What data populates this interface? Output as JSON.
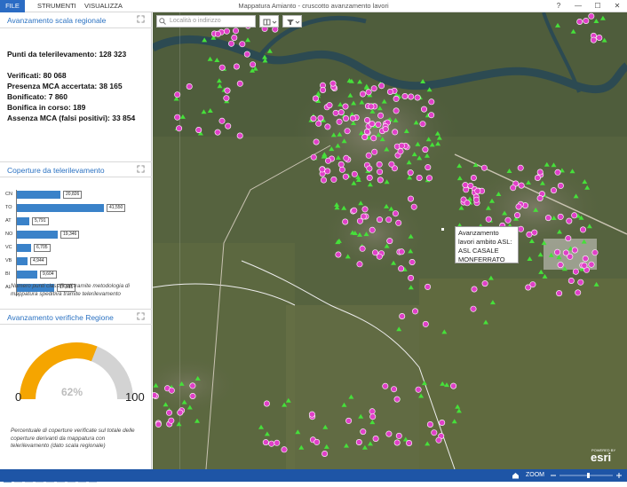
{
  "window": {
    "menu": {
      "file": "FILE",
      "tools": "STRUMENTI",
      "view": "VISUALIZZA"
    },
    "title": "Mappatura Amianto - cruscotto avanzamento lavori",
    "controls": {
      "help": "?",
      "minimize": "—",
      "maximize": "☐",
      "close": "✕"
    }
  },
  "panel1": {
    "title": "Avanzamento scala regionale",
    "lines": [
      "Punti da telerilevamento: 128 323",
      "Verificati: 80 068",
      "Presenza MCA accertata: 38 165",
      "Bonificato: 7 860",
      "Bonifica in corso: 189",
      "Assenza MCA (falsi positivi): 33 854"
    ]
  },
  "panel2": {
    "title": "Coperture  da telerilevamento",
    "note": "Numero punti classificati tramite metodologia di mappatura speditiva tramite telerilevamento"
  },
  "chart_data": {
    "type": "bar",
    "orientation": "horizontal",
    "categories": [
      "CN",
      "TO",
      "AT",
      "NO",
      "VC",
      "VB",
      "BI",
      "AL"
    ],
    "values": [
      20826,
      41550,
      5791,
      19346,
      6705,
      4944,
      9604,
      17815
    ],
    "labels": [
      "20,826",
      "41,550",
      "5,791",
      "19,346",
      "6,705",
      "4,944",
      "9,604",
      "17,815"
    ]
  },
  "panel3": {
    "title": "Avanzamento verifiche Regione",
    "gauge": {
      "value": 62,
      "label": "62%",
      "min": "0",
      "max": "100"
    },
    "note": "Percentuale di coperture verificate sul totale delle coperture derivanti da mappatura con telerilevamento (dato scala regionale)"
  },
  "map": {
    "search_placeholder": "Località o indirizzo",
    "popup": "Avanzamento lavori ambito ASL: ASL CASALE MONFERRATO",
    "zoom_label": "ZOOM",
    "powered_by": "POWERED BY",
    "brand": "esri"
  },
  "colors": {
    "accent": "#2b72c2",
    "bar": "#3a82c9",
    "gauge_fill": "#f5a500",
    "gauge_track": "#d3d3d3",
    "point_asbestos": "#e040c8",
    "point_verified": "#46e03a"
  }
}
